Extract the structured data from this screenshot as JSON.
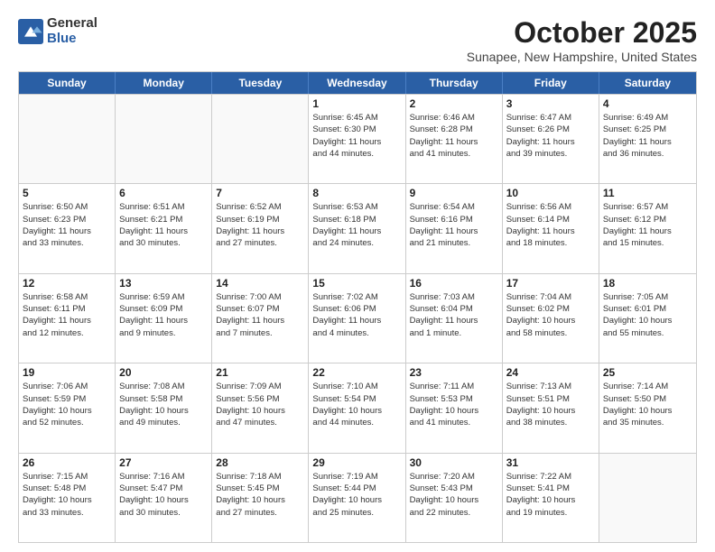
{
  "logo": {
    "general": "General",
    "blue": "Blue"
  },
  "title": "October 2025",
  "subtitle": "Sunapee, New Hampshire, United States",
  "weekdays": [
    "Sunday",
    "Monday",
    "Tuesday",
    "Wednesday",
    "Thursday",
    "Friday",
    "Saturday"
  ],
  "rows": [
    [
      {
        "day": "",
        "info": "",
        "empty": true
      },
      {
        "day": "",
        "info": "",
        "empty": true
      },
      {
        "day": "",
        "info": "",
        "empty": true
      },
      {
        "day": "1",
        "info": "Sunrise: 6:45 AM\nSunset: 6:30 PM\nDaylight: 11 hours\nand 44 minutes."
      },
      {
        "day": "2",
        "info": "Sunrise: 6:46 AM\nSunset: 6:28 PM\nDaylight: 11 hours\nand 41 minutes."
      },
      {
        "day": "3",
        "info": "Sunrise: 6:47 AM\nSunset: 6:26 PM\nDaylight: 11 hours\nand 39 minutes."
      },
      {
        "day": "4",
        "info": "Sunrise: 6:49 AM\nSunset: 6:25 PM\nDaylight: 11 hours\nand 36 minutes."
      }
    ],
    [
      {
        "day": "5",
        "info": "Sunrise: 6:50 AM\nSunset: 6:23 PM\nDaylight: 11 hours\nand 33 minutes."
      },
      {
        "day": "6",
        "info": "Sunrise: 6:51 AM\nSunset: 6:21 PM\nDaylight: 11 hours\nand 30 minutes."
      },
      {
        "day": "7",
        "info": "Sunrise: 6:52 AM\nSunset: 6:19 PM\nDaylight: 11 hours\nand 27 minutes."
      },
      {
        "day": "8",
        "info": "Sunrise: 6:53 AM\nSunset: 6:18 PM\nDaylight: 11 hours\nand 24 minutes."
      },
      {
        "day": "9",
        "info": "Sunrise: 6:54 AM\nSunset: 6:16 PM\nDaylight: 11 hours\nand 21 minutes."
      },
      {
        "day": "10",
        "info": "Sunrise: 6:56 AM\nSunset: 6:14 PM\nDaylight: 11 hours\nand 18 minutes."
      },
      {
        "day": "11",
        "info": "Sunrise: 6:57 AM\nSunset: 6:12 PM\nDaylight: 11 hours\nand 15 minutes."
      }
    ],
    [
      {
        "day": "12",
        "info": "Sunrise: 6:58 AM\nSunset: 6:11 PM\nDaylight: 11 hours\nand 12 minutes."
      },
      {
        "day": "13",
        "info": "Sunrise: 6:59 AM\nSunset: 6:09 PM\nDaylight: 11 hours\nand 9 minutes."
      },
      {
        "day": "14",
        "info": "Sunrise: 7:00 AM\nSunset: 6:07 PM\nDaylight: 11 hours\nand 7 minutes."
      },
      {
        "day": "15",
        "info": "Sunrise: 7:02 AM\nSunset: 6:06 PM\nDaylight: 11 hours\nand 4 minutes."
      },
      {
        "day": "16",
        "info": "Sunrise: 7:03 AM\nSunset: 6:04 PM\nDaylight: 11 hours\nand 1 minute."
      },
      {
        "day": "17",
        "info": "Sunrise: 7:04 AM\nSunset: 6:02 PM\nDaylight: 10 hours\nand 58 minutes."
      },
      {
        "day": "18",
        "info": "Sunrise: 7:05 AM\nSunset: 6:01 PM\nDaylight: 10 hours\nand 55 minutes."
      }
    ],
    [
      {
        "day": "19",
        "info": "Sunrise: 7:06 AM\nSunset: 5:59 PM\nDaylight: 10 hours\nand 52 minutes."
      },
      {
        "day": "20",
        "info": "Sunrise: 7:08 AM\nSunset: 5:58 PM\nDaylight: 10 hours\nand 49 minutes."
      },
      {
        "day": "21",
        "info": "Sunrise: 7:09 AM\nSunset: 5:56 PM\nDaylight: 10 hours\nand 47 minutes."
      },
      {
        "day": "22",
        "info": "Sunrise: 7:10 AM\nSunset: 5:54 PM\nDaylight: 10 hours\nand 44 minutes."
      },
      {
        "day": "23",
        "info": "Sunrise: 7:11 AM\nSunset: 5:53 PM\nDaylight: 10 hours\nand 41 minutes."
      },
      {
        "day": "24",
        "info": "Sunrise: 7:13 AM\nSunset: 5:51 PM\nDaylight: 10 hours\nand 38 minutes."
      },
      {
        "day": "25",
        "info": "Sunrise: 7:14 AM\nSunset: 5:50 PM\nDaylight: 10 hours\nand 35 minutes."
      }
    ],
    [
      {
        "day": "26",
        "info": "Sunrise: 7:15 AM\nSunset: 5:48 PM\nDaylight: 10 hours\nand 33 minutes."
      },
      {
        "day": "27",
        "info": "Sunrise: 7:16 AM\nSunset: 5:47 PM\nDaylight: 10 hours\nand 30 minutes."
      },
      {
        "day": "28",
        "info": "Sunrise: 7:18 AM\nSunset: 5:45 PM\nDaylight: 10 hours\nand 27 minutes."
      },
      {
        "day": "29",
        "info": "Sunrise: 7:19 AM\nSunset: 5:44 PM\nDaylight: 10 hours\nand 25 minutes."
      },
      {
        "day": "30",
        "info": "Sunrise: 7:20 AM\nSunset: 5:43 PM\nDaylight: 10 hours\nand 22 minutes."
      },
      {
        "day": "31",
        "info": "Sunrise: 7:22 AM\nSunset: 5:41 PM\nDaylight: 10 hours\nand 19 minutes."
      },
      {
        "day": "",
        "info": "",
        "empty": true
      }
    ]
  ]
}
